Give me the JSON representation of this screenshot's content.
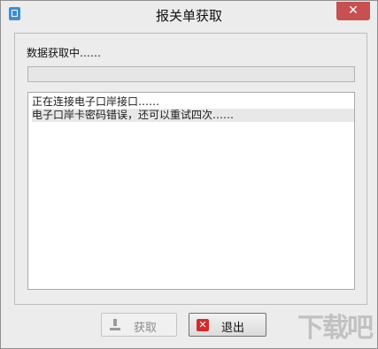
{
  "window": {
    "title": "报关单获取",
    "close_glyph": "✕"
  },
  "status": {
    "label": "数据获取中……"
  },
  "progress": {
    "value_percent": 0
  },
  "log": {
    "lines": [
      "正在连接电子口岸接口……",
      "电子口岸卡密码错误，还可以重试四次……"
    ]
  },
  "buttons": {
    "fetch_label": "获取",
    "exit_label": "退出",
    "exit_icon_glyph": "✕"
  },
  "watermark": {
    "text": "下载吧"
  },
  "icons": {
    "app": "app-icon",
    "close": "close-icon",
    "fetch": "download-icon",
    "exit": "exit-icon"
  }
}
